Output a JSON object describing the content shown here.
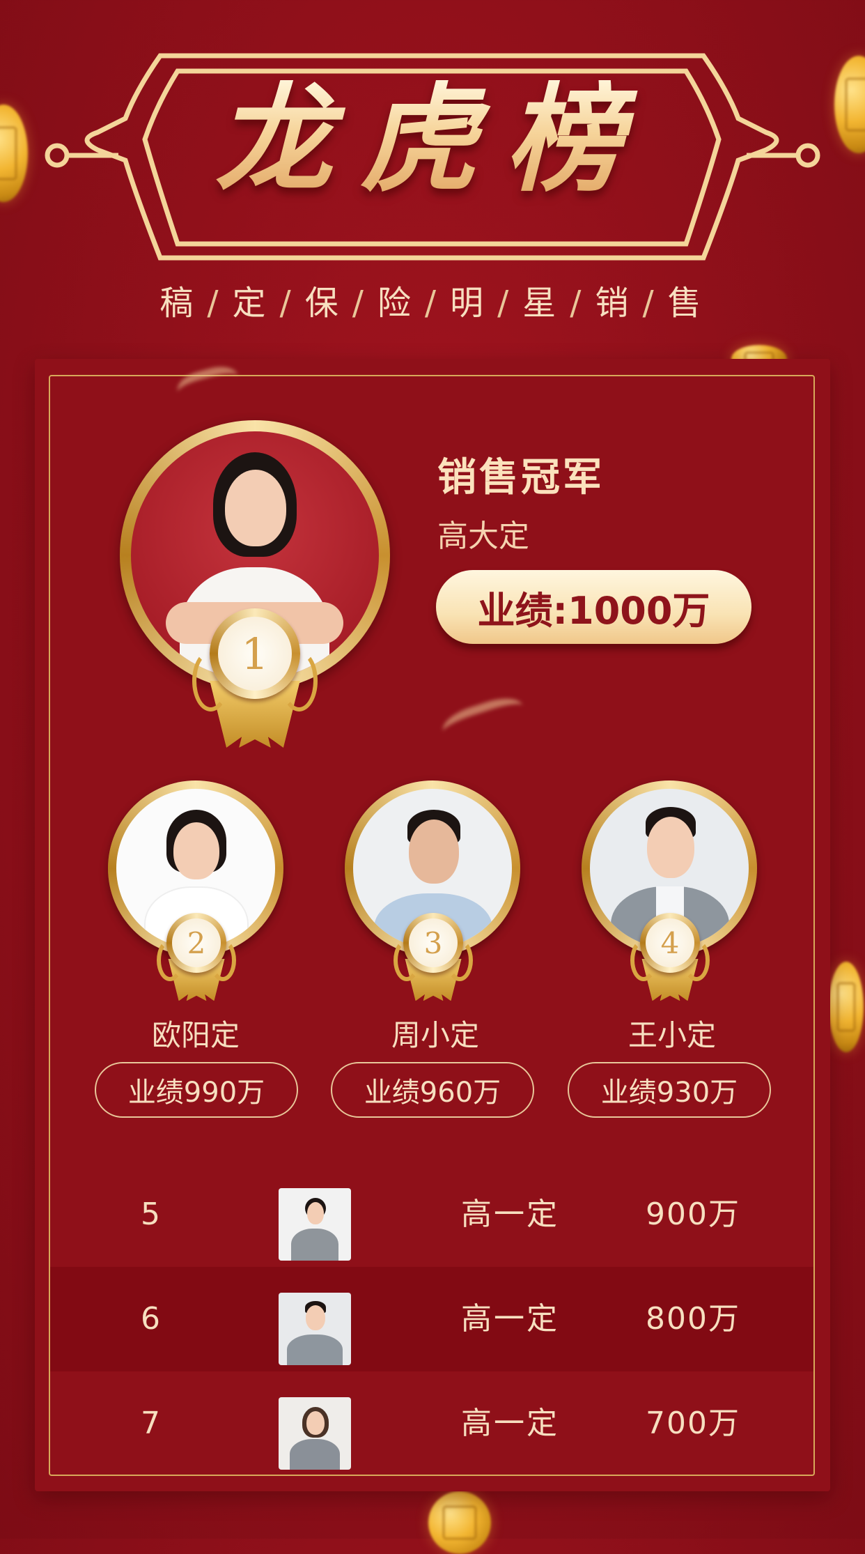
{
  "header": {
    "title": "龙虎榜",
    "subtitle_words": [
      "稿",
      "定",
      "保",
      "险",
      "明",
      "星",
      "销",
      "售"
    ],
    "subtitle_separator": "/"
  },
  "champion": {
    "rank": "1",
    "label": "销售冠军",
    "name": "高大定",
    "performance": "业绩:1000万"
  },
  "runners_up": [
    {
      "rank": "2",
      "name": "欧阳定",
      "performance": "业绩990万"
    },
    {
      "rank": "3",
      "name": "周小定",
      "performance": "业绩960万"
    },
    {
      "rank": "4",
      "name": "王小定",
      "performance": "业绩930万"
    }
  ],
  "ranking_list": [
    {
      "rank": "5",
      "name": "高一定",
      "value": "900万"
    },
    {
      "rank": "6",
      "name": "高一定",
      "value": "800万"
    },
    {
      "rank": "7",
      "name": "高一定",
      "value": "700万"
    }
  ],
  "colors": {
    "background": "#8c0f19",
    "gold": "#d8a95a",
    "cream_text": "#f7dfc0",
    "pill_text": "#8e141b"
  },
  "icons": [
    "gold-coin-icon",
    "medal-icon",
    "laurel-icon",
    "ribbon-icon"
  ]
}
